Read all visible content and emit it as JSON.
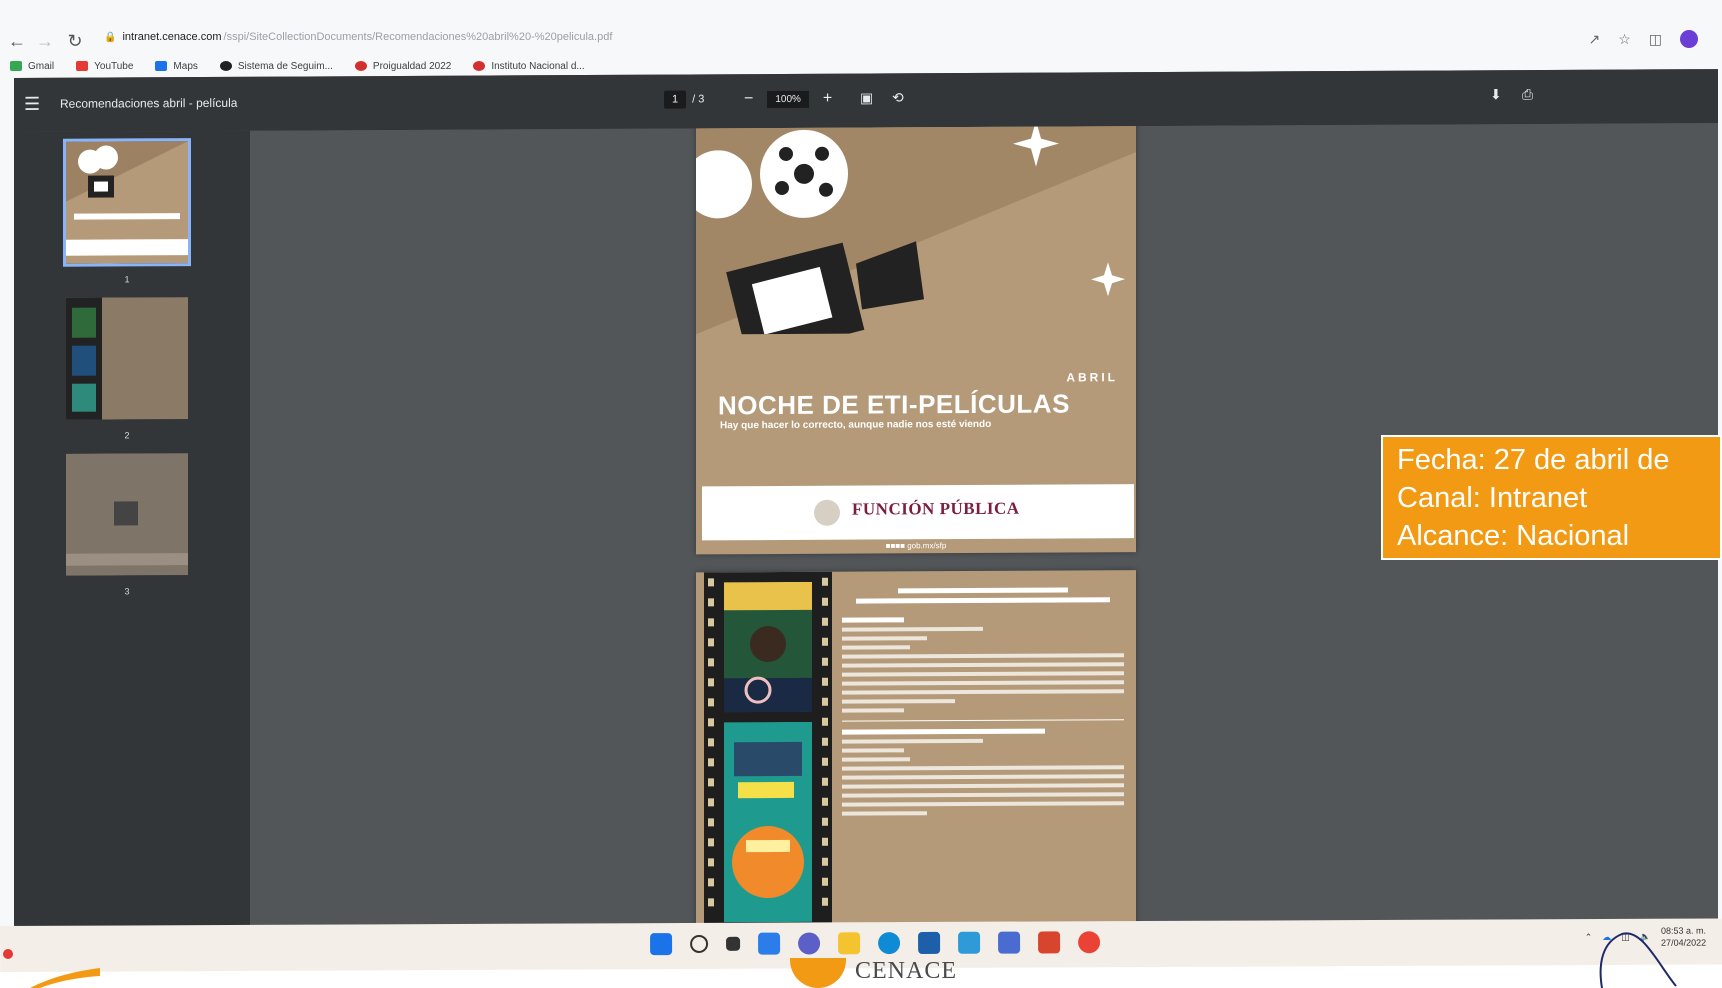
{
  "browser": {
    "url_host": "intranet.cenace.com",
    "url_path": "/sspi/SiteCollectionDocuments/Recomendaciones%20abril%20-%20pelicula.pdf",
    "bookmarks": [
      {
        "label": "Gmail",
        "color": "#34a853"
      },
      {
        "label": "YouTube",
        "color": "#e53935"
      },
      {
        "label": "Maps",
        "color": "#1a73e8"
      },
      {
        "label": "Sistema de Seguim...",
        "color": "#202124"
      },
      {
        "label": "Proigualdad 2022",
        "color": "#d32f2f"
      },
      {
        "label": "Instituto Nacional d...",
        "color": "#d32f2f"
      }
    ]
  },
  "pdf": {
    "title": "Recomendaciones abril - película",
    "page_current": "1",
    "page_total": "/ 3",
    "zoom": "100%",
    "thumbnails": [
      "1",
      "2",
      "3"
    ],
    "cover": {
      "month": "ABRIL",
      "headline": "NOCHE DE ETI-PELÍCULAS",
      "tagline": "Hay que hacer lo correcto, aunque nadie nos esté viendo",
      "org": "FUNCIÓN PÚBLICA",
      "footer": "gob.mx/sfp"
    }
  },
  "overlay": {
    "line1": "Fecha: 27 de abril de",
    "line2": "Canal: Intranet",
    "line3": "Alcance: Nacional"
  },
  "taskbar": {
    "time": "08:53 a. m.",
    "date": "27/04/2022"
  },
  "footer": {
    "logo_text": "CENACE"
  },
  "colors": {
    "accent_orange": "#f39a14",
    "pdf_beige": "#b49a78",
    "fp_maroon": "#7d1d3f"
  }
}
